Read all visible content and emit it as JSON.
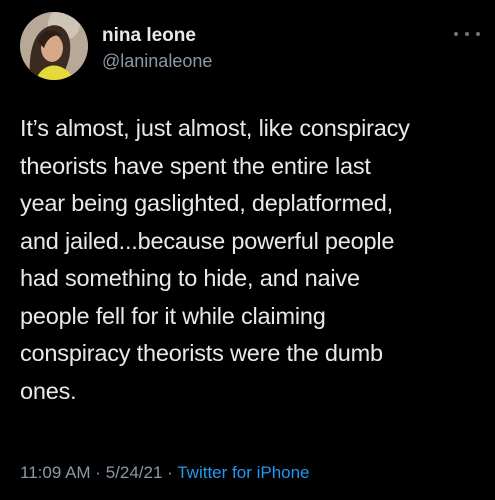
{
  "author": {
    "display_name": "nina leone",
    "handle": "@laninaleone",
    "avatar_icon": "profile-photo"
  },
  "tweet": {
    "lines": [
      "It’s almost, just almost, like conspiracy",
      "theorists have spent the entire last",
      "year being gaslighted, deplatformed,",
      "and jailed...because powerful people",
      "had something to hide, and naive",
      "people fell for it while claiming",
      "conspiracy theorists were the dumb",
      "ones."
    ]
  },
  "meta": {
    "time": "11:09 AM",
    "separator": " · ",
    "date": "5/24/21",
    "source": "Twitter for iPhone"
  },
  "colors": {
    "background": "#000000",
    "text": "#e7e9ea",
    "secondary": "#8b98a5",
    "link": "#1d9bf0"
  }
}
